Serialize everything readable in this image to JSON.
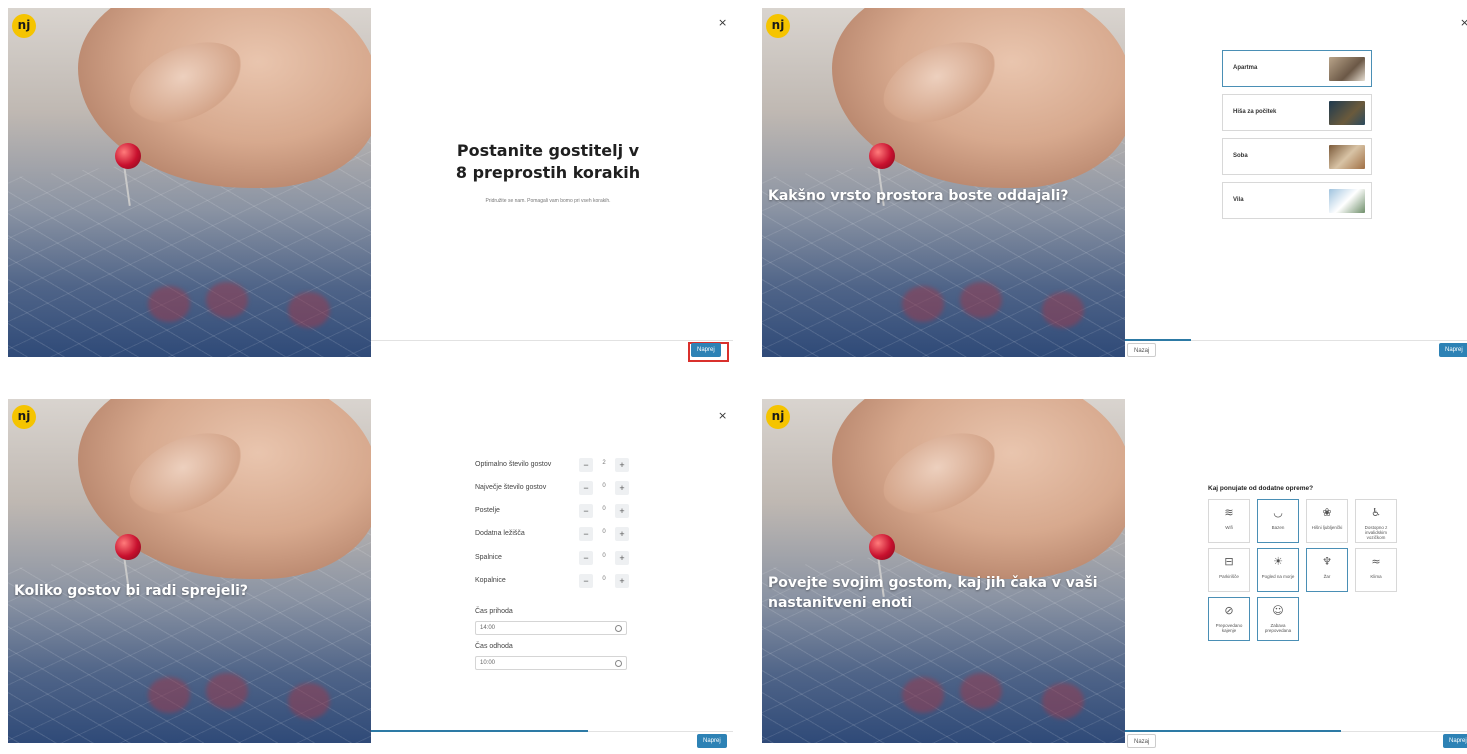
{
  "logo": "nj",
  "close_symbol": "×",
  "panel1": {
    "title_line1": "Postanite gostitelj v",
    "title_line2": "8 preprostih korakih",
    "subtitle": "Pridružite se nam. Pomagali vam bomo pri vseh korakih.",
    "next_label": "Naprej"
  },
  "panel2": {
    "hero_title": "Kakšno vrsto prostora boste oddajali?",
    "items": [
      {
        "label": "Apartma",
        "selected": true
      },
      {
        "label": "Hiša za počitek",
        "selected": false
      },
      {
        "label": "Soba",
        "selected": false
      },
      {
        "label": "Vila",
        "selected": false
      }
    ],
    "back_label": "Nazaj",
    "next_label": "Naprej"
  },
  "panel3": {
    "hero_title": "Koliko gostov bi radi sprejeli?",
    "counters": [
      {
        "label": "Optimalno število gostov",
        "value": "2"
      },
      {
        "label": "Največje število gostov",
        "value": "0"
      },
      {
        "label": "Postelje",
        "value": "0"
      },
      {
        "label": "Dodatna ležišča",
        "value": "0"
      },
      {
        "label": "Spalnice",
        "value": "0"
      },
      {
        "label": "Kopalnice",
        "value": "0"
      }
    ],
    "minus": "−",
    "plus": "+",
    "checkin_label": "Čas prihoda",
    "checkin_value": "14:00",
    "checkout_label": "Čas odhoda",
    "checkout_value": "10:00",
    "next_label": "Naprej"
  },
  "panel4": {
    "hero_title_line1": "Povejte svojim gostom, kaj jih čaka v vaši",
    "hero_title_line2": "nastanitveni enoti",
    "section_title": "Kaj ponujate od dodatne opreme?",
    "amenities": [
      {
        "label": "Wifi",
        "icon": "wifi-icon",
        "glyph": "≋",
        "selected": false
      },
      {
        "label": "Bazen",
        "icon": "pool-icon",
        "glyph": "◡",
        "selected": true
      },
      {
        "label": "Hišni ljubljenčki",
        "icon": "pet-icon",
        "glyph": "❀",
        "selected": false
      },
      {
        "label": "Dostopno z invalidskim vozičkom",
        "icon": "wheelchair-icon",
        "glyph": "♿",
        "selected": false
      },
      {
        "label": "Parkirišče",
        "icon": "car-icon",
        "glyph": "⊟",
        "selected": false
      },
      {
        "label": "Pogled na morje",
        "icon": "sun-icon",
        "glyph": "☀",
        "selected": true
      },
      {
        "label": "Žar",
        "icon": "grill-icon",
        "glyph": "♆",
        "selected": true
      },
      {
        "label": "Klima",
        "icon": "air-icon",
        "glyph": "≈",
        "selected": false
      },
      {
        "label": "Prepovedano kajenje",
        "icon": "no-smoking-icon",
        "glyph": "⊘",
        "selected": true
      },
      {
        "label": "Zabava prepovedana",
        "icon": "people-icon",
        "glyph": "☺",
        "selected": true
      }
    ],
    "back_label": "Nazaj",
    "next_label": "Naprej"
  }
}
